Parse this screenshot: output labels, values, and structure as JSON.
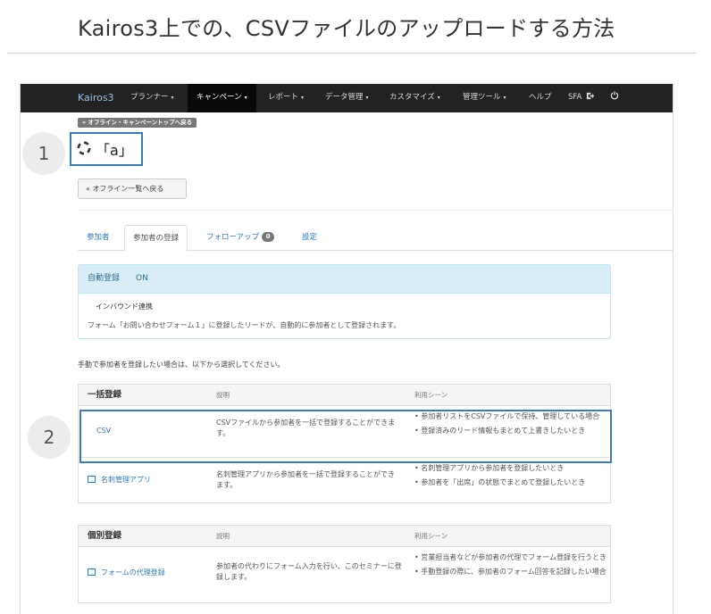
{
  "doc": {
    "title": "Kairos3上での、CSVファイルのアップロードする方法"
  },
  "navbar": {
    "brand": "Kairos3",
    "items": [
      {
        "label": "プランナー",
        "caret": "▾"
      },
      {
        "label": "キャンペーン",
        "caret": "▾"
      },
      {
        "label": "レポート",
        "caret": "▾"
      },
      {
        "label": "データ管理",
        "caret": "▾"
      },
      {
        "label": "カスタマイズ",
        "caret": "▾"
      },
      {
        "label": "管理ツール",
        "caret": "▾"
      },
      {
        "label": "ヘルプ",
        "caret": ""
      },
      {
        "label": "SFA",
        "caret": ""
      }
    ],
    "active_item": "キャンペーン",
    "sfa_icon": "external-link-icon",
    "power_icon": "power-icon"
  },
  "page": {
    "back_to_top": "« オフライン・キャンペーントップへ戻る",
    "campaign_title": "「a」",
    "campaign_icon": "offline-campaign-icon",
    "back_to_list": "« オフライン一覧へ戻る"
  },
  "tabs": [
    {
      "label": "参加者"
    },
    {
      "label": "参加者の登録",
      "active": true
    },
    {
      "label": "フォローアップ",
      "badge": "0"
    },
    {
      "label": "設定"
    }
  ],
  "auto_register": {
    "label": "自動登録",
    "status": "ON",
    "subheading": "インバウンド連携",
    "description": "フォーム「お問い合わせフォーム１」に登録したリードが、自動的に参加者として登録されます。"
  },
  "manual_prompt": "手動で参加者を登録したい場合は、以下から選択してください。",
  "bulk": {
    "heading": "一括登録",
    "col_desc": "説明",
    "col_scene": "利用シーン",
    "rows": [
      {
        "name": "CSV",
        "description": "CSVファイルから参加者を一括で登録することができます。",
        "scenes": [
          "参加者リストをCSVファイルで保持、管理している場合",
          "登録済みのリード情報もまとめて上書きしたいとき"
        ]
      },
      {
        "name": "名刺管理アプリ",
        "description": "名刺管理アプリから参加者を一括で登録することができます。",
        "scenes": [
          "名刺管理アプリから参加者を登録したいとき",
          "参加者を「出席」の状態でまとめて登録したいとき"
        ]
      }
    ]
  },
  "individual": {
    "heading": "個別登録",
    "col_desc": "説明",
    "col_scene": "利用シーン",
    "rows": [
      {
        "name": "フォームの代理登録",
        "description": "参加者の代わりにフォーム入力を行い、このセミナーに登録します。",
        "scenes": [
          "営業担当者などが参加者の代理でフォーム登録を行うとき",
          "手動登録の際に、参加者のフォーム回答を記録したい場合"
        ]
      }
    ]
  },
  "steps": [
    "1",
    "2"
  ],
  "colors": {
    "highlight": "#3b7bb9",
    "navbar": "#222222",
    "link": "#337ab7",
    "info_panel": "#d9edf7"
  }
}
